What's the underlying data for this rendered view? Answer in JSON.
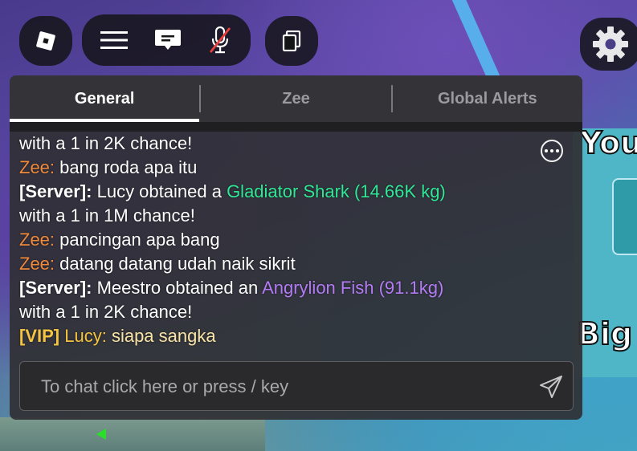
{
  "tabs": [
    {
      "label": "General",
      "active": true
    },
    {
      "label": "Zee",
      "active": false
    },
    {
      "label": "Global Alerts",
      "active": false
    }
  ],
  "messages": {
    "l1": {
      "text": "with a 1 in 2K chance!"
    },
    "l2": {
      "name": "Zee:",
      "text": " bang roda apa itu"
    },
    "l3": {
      "prefix": "[Server]:",
      "text": " Lucy obtained a ",
      "item": "Gladiator Shark (14.66K kg)"
    },
    "l4": {
      "text": "with a 1 in 1M chance!"
    },
    "l5": {
      "name": "Zee:",
      "text": " pancingan apa bang"
    },
    "l6": {
      "name": "Zee:",
      "text": " datang datang udah naik sikrit"
    },
    "l7": {
      "prefix": "[Server]:",
      "text": " Meestro obtained an ",
      "item": "Angrylion Fish (91.1kg)"
    },
    "l8": {
      "text": "with a 1 in 2K chance!"
    },
    "l9": {
      "tag": "[VIP]",
      "name": " Lucy:",
      "text": " siapa sangka"
    }
  },
  "input": {
    "placeholder": "To chat click here or press / key",
    "value": ""
  },
  "background_text": {
    "you": "You",
    "big": "Big"
  },
  "colors": {
    "name_orange": "#f08a3c",
    "gladiator_green": "#2ee896",
    "angrylion_purple": "#b37cf5",
    "vip_gold": "#f5c542"
  },
  "icons": {
    "roblox": "roblox-logo-icon",
    "menu": "hamburger-menu-icon",
    "chat": "chat-bubble-icon",
    "mic": "microphone-muted-icon",
    "backpack": "backpack-icon",
    "settings": "gear-icon",
    "more": "more-options-icon",
    "send": "send-icon"
  }
}
